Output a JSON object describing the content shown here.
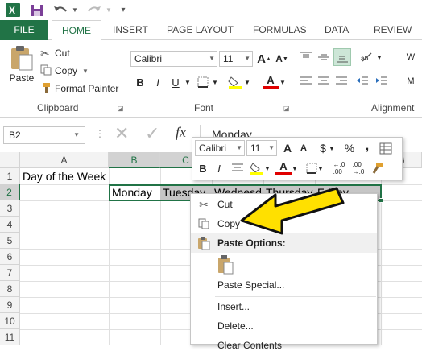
{
  "title_bar": {
    "app_icon": "excel-icon",
    "save_icon": "save-icon",
    "undo_icon": "undo-icon",
    "redo_icon": "redo-icon"
  },
  "tabs": [
    "FILE",
    "HOME",
    "INSERT",
    "PAGE LAYOUT",
    "FORMULAS",
    "DATA",
    "REVIEW"
  ],
  "clipboard": {
    "paste": "Paste",
    "cut": "Cut",
    "copy": "Copy",
    "format_painter": "Format Painter",
    "group": "Clipboard"
  },
  "font": {
    "name": "Calibri",
    "size": "11",
    "bold": "B",
    "italic": "I",
    "underline": "U",
    "font_color": "A",
    "group": "Font"
  },
  "alignment": {
    "group": "Alignment",
    "wrap": "W",
    "merge": "M"
  },
  "formula_bar": {
    "name_box": "B2",
    "fx": "fx",
    "content": "Monday"
  },
  "columns": [
    "A",
    "B",
    "C",
    "G"
  ],
  "rows": [
    "1",
    "2",
    "3",
    "4",
    "5",
    "6",
    "7",
    "8",
    "9",
    "10",
    "11"
  ],
  "cells": {
    "A1": "Day of the Week",
    "B2": "Monday",
    "C2": "Tuesday",
    "D2": "Wednesday",
    "E2": "Thursday",
    "F2": "Friday"
  },
  "mini_toolbar": {
    "font": "Calibri",
    "size": "11",
    "grow": "A",
    "shrink": "A",
    "currency": "$",
    "percent": "%",
    "comma": ",",
    "bold": "B",
    "italic": "I",
    "font_color": "A"
  },
  "context_menu": {
    "cut": "Cut",
    "copy": "Copy",
    "paste_options": "Paste Options:",
    "paste_special": "Paste Special...",
    "insert": "Insert...",
    "delete": "Delete...",
    "clear": "Clear Contents"
  },
  "colors": {
    "excel_green": "#217346",
    "selection": "#c6c6c6",
    "arrow": "#ffe000"
  }
}
